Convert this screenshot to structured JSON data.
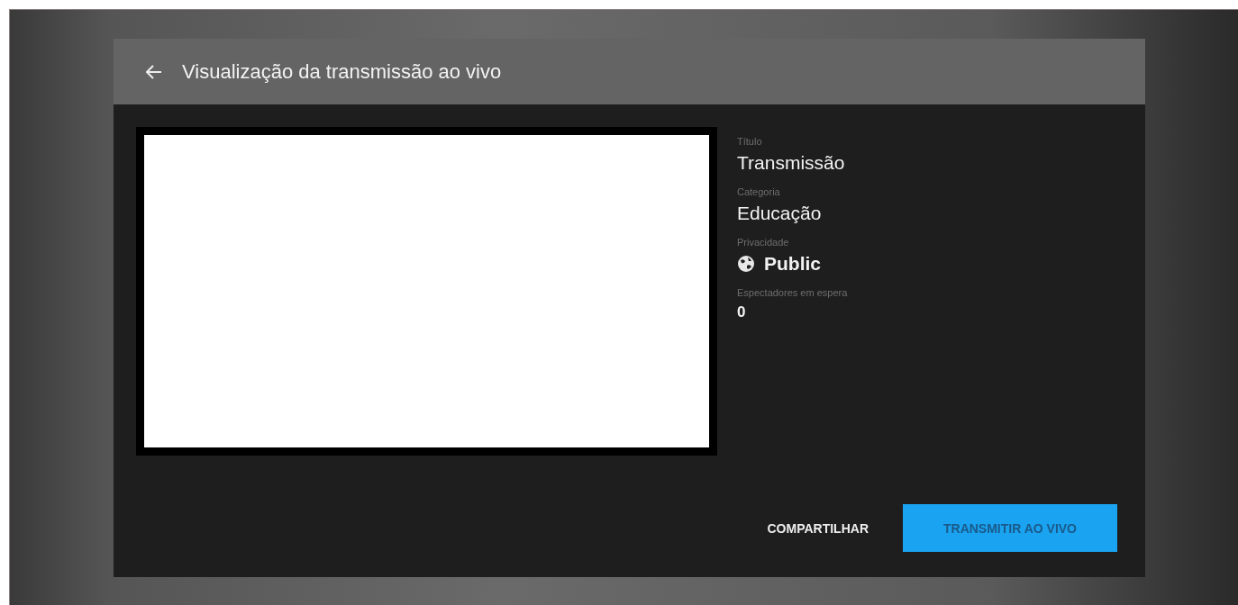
{
  "dialog": {
    "title": "Visualização da transmissão ao vivo"
  },
  "details": [
    {
      "label": "Título",
      "value": "Transmissão",
      "kind": "text"
    },
    {
      "label": "Categoria",
      "value": "Educação",
      "kind": "text"
    },
    {
      "label": "Privacidade",
      "value": "Public",
      "kind": "privacy"
    },
    {
      "label": "Espectadores em espera",
      "value": "0",
      "kind": "count"
    }
  ],
  "buttons": [
    {
      "label": "COMPARTILHAR",
      "kind": "text"
    },
    {
      "label": "TRANSMITIR AO VIVO",
      "kind": "primary"
    }
  ]
}
